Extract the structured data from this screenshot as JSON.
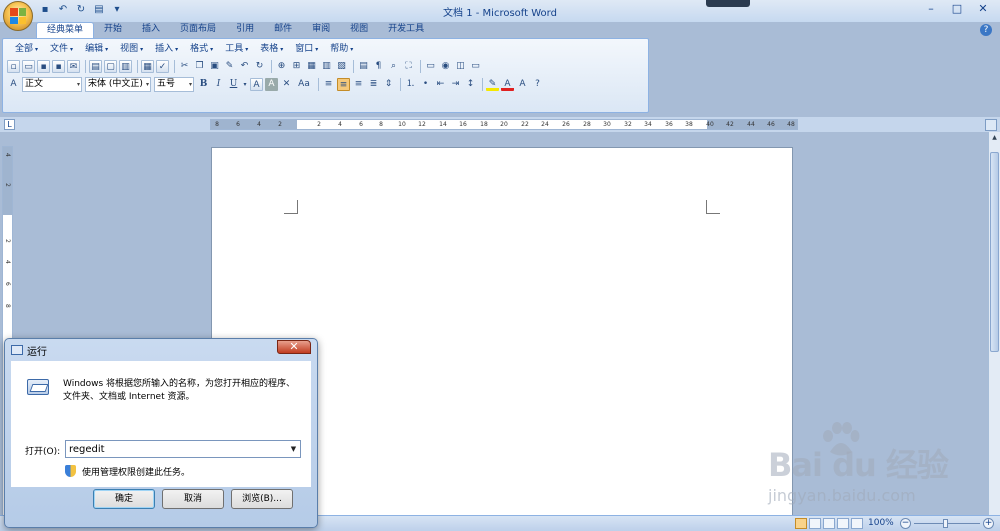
{
  "window": {
    "title": "文档 1 - Microsoft Word",
    "minimize": "–",
    "maximize": "□",
    "close": "✕"
  },
  "tabs": [
    {
      "label": "经典菜单",
      "active": true
    },
    {
      "label": "开始"
    },
    {
      "label": "插入"
    },
    {
      "label": "页面布局"
    },
    {
      "label": "引用"
    },
    {
      "label": "邮件"
    },
    {
      "label": "审阅"
    },
    {
      "label": "视图"
    },
    {
      "label": "开发工具"
    }
  ],
  "menu": [
    "全部",
    "文件",
    "编辑",
    "视图",
    "插入",
    "格式",
    "工具",
    "表格",
    "窗口",
    "帮助"
  ],
  "formatting": {
    "style": "正文",
    "font": "宋体 (中文正)",
    "size": "五号",
    "bold": "B",
    "italic": "I",
    "underline": "U",
    "font_color_letter": "A",
    "change_case": "Aa"
  },
  "ruler": {
    "horizontal_ticks": [
      "8",
      "6",
      "4",
      "2",
      "",
      "2",
      "4",
      "6",
      "8",
      "10",
      "12",
      "14",
      "16",
      "18",
      "20",
      "22",
      "24",
      "26",
      "28",
      "30",
      "32",
      "34",
      "36",
      "38",
      "40",
      "42",
      "44",
      "46",
      "48"
    ],
    "vertical_ticks": [
      "4",
      "2",
      "",
      "2",
      "4",
      "6",
      "8",
      "10",
      "12"
    ]
  },
  "status": {
    "zoom": "100%"
  },
  "run_dialog": {
    "title": "运行",
    "description": "Windows 将根据您所输入的名称，为您打开相应的程序、文件夹、文档或 Internet 资源。",
    "open_label": "打开(O):",
    "open_value": "regedit",
    "admin_note": "使用管理权限创建此任务。",
    "ok": "确定",
    "cancel": "取消",
    "browse": "浏览(B)..."
  },
  "watermark": {
    "brand": "Bai du 经验",
    "site": "jingyan.baidu.com"
  },
  "colors": {
    "ribbon_border": "#8db2e3",
    "title_text": "#15428b",
    "workspace": "#a9bcd6"
  }
}
